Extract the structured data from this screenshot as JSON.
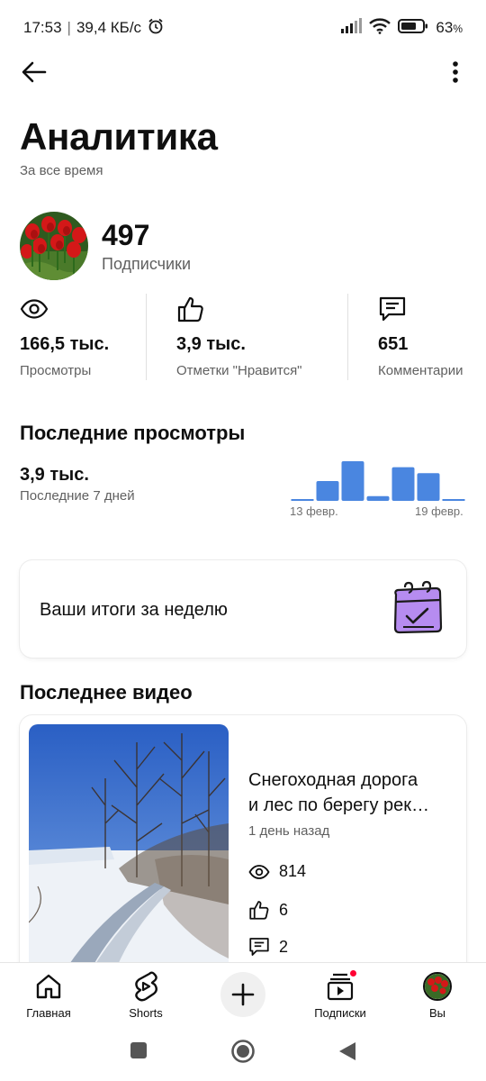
{
  "status_bar": {
    "time": "17:53",
    "separator": "|",
    "speed": "39,4 КБ/с",
    "battery": "63",
    "battery_unit": "%"
  },
  "page": {
    "title": "Аналитика",
    "subtitle": "За все время"
  },
  "channel": {
    "subscribers_count": "497",
    "subscribers_label": "Подписчики"
  },
  "stats": [
    {
      "icon": "eye-icon",
      "value": "166,5 тыс.",
      "label": "Просмотры"
    },
    {
      "icon": "thumb-up-icon",
      "value": "3,9 тыс.",
      "label": "Отметки \"Нравится\""
    },
    {
      "icon": "comment-icon",
      "value": "651",
      "label": "Комментарии"
    }
  ],
  "recent_views": {
    "title": "Последние просмотры",
    "value": "3,9 тыс.",
    "period": "Последние 7 дней",
    "start_label": "13 февр.",
    "end_label": "19 февр."
  },
  "chart_data": {
    "type": "bar",
    "categories": [
      "13 февр.",
      "14 февр.",
      "15 февр.",
      "16 февр.",
      "17 февр.",
      "18 февр.",
      "19 февр."
    ],
    "values": [
      0.02,
      0.5,
      1.0,
      0.12,
      0.85,
      0.7,
      0.03
    ],
    "color": "#4a86e0",
    "xlabel": "",
    "ylabel": ""
  },
  "weekly": {
    "label": "Ваши итоги за неделю",
    "icon": "calendar-check-icon"
  },
  "last_video": {
    "section_title": "Последнее видео",
    "title_line1": "Снегоходная дорога",
    "title_line2": "и лес по берегу рек…",
    "age": "1 день назад",
    "views": "814",
    "likes": "6",
    "comments": "2"
  },
  "bottom_nav": {
    "home": "Главная",
    "shorts": "Shorts",
    "subscriptions": "Подписки",
    "you": "Вы"
  },
  "colors": {
    "accent": "#4a86e0",
    "notification": "#ff0033",
    "calendar": "#b68cf0"
  }
}
